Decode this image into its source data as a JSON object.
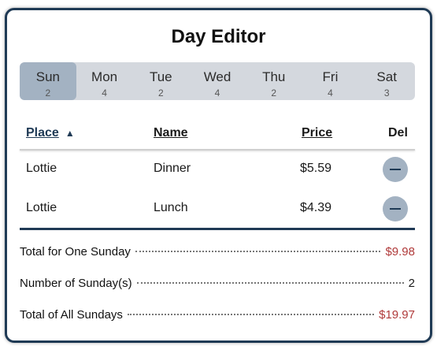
{
  "title": "Day Editor",
  "tabs": [
    {
      "day": "Sun",
      "count": "2",
      "active": true
    },
    {
      "day": "Mon",
      "count": "4"
    },
    {
      "day": "Tue",
      "count": "2"
    },
    {
      "day": "Wed",
      "count": "4"
    },
    {
      "day": "Thu",
      "count": "2"
    },
    {
      "day": "Fri",
      "count": "4"
    },
    {
      "day": "Sat",
      "count": "3"
    }
  ],
  "table": {
    "headers": {
      "place": "Place",
      "name": "Name",
      "price": "Price",
      "del": "Del"
    },
    "sort_icon": "caret-up-icon",
    "rows": [
      {
        "place": "Lottie",
        "name": "Dinner",
        "price": "$5.59"
      },
      {
        "place": "Lottie",
        "name": "Lunch",
        "price": "$4.39"
      }
    ]
  },
  "summary": {
    "total_one_label": "Total for One Sunday",
    "total_one_value": "$9.98",
    "count_label": "Number of Sunday(s)",
    "count_value": "2",
    "total_all_label": "Total of All Sundays",
    "total_all_value": "$19.97"
  },
  "colors": {
    "accent": "#1f3a55",
    "money": "#b03a3a",
    "active_tab": "#a3b2c2"
  }
}
